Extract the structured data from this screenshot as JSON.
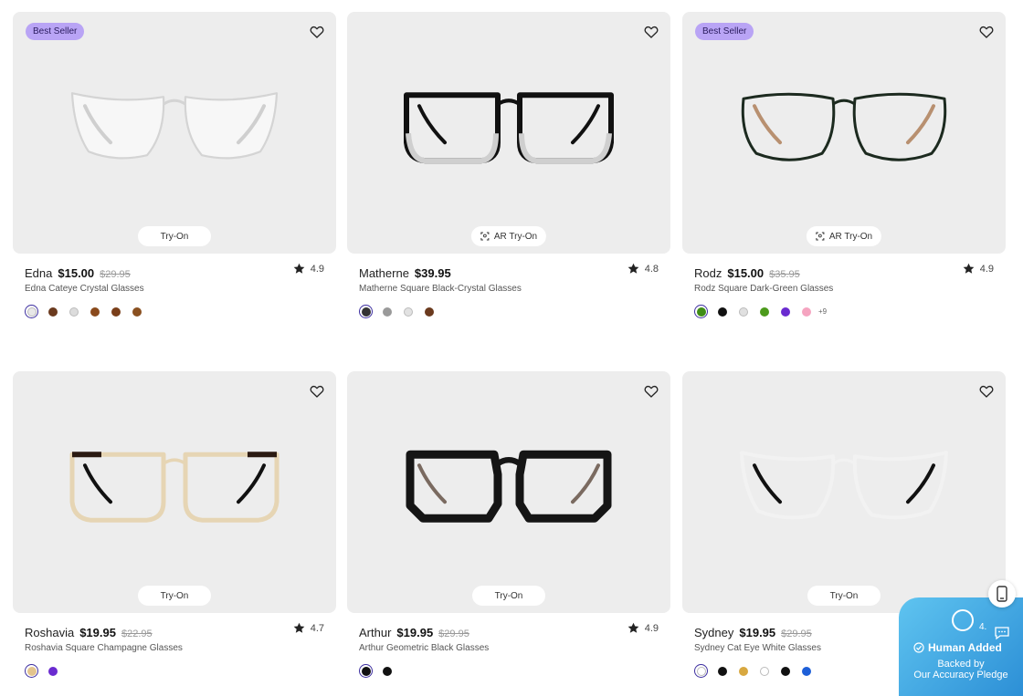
{
  "products": [
    {
      "badge": "Best Seller",
      "name": "Edna",
      "price": "$15.00",
      "old_price": "$29.95",
      "full_name": "Edna Cateye Crystal Glasses",
      "rating": "4.9",
      "try_on": "Try-On",
      "ar": false,
      "frame": "crystal",
      "swatches": [
        "#e8e8e8",
        "#6b3a1e",
        "#dcdcdc",
        "#8a4a1c",
        "#7a3f1a",
        "#8a5020"
      ],
      "more": ""
    },
    {
      "badge": "",
      "name": "Matherne",
      "price": "$39.95",
      "old_price": "",
      "full_name": "Matherne Square Black-Crystal Glasses",
      "rating": "4.8",
      "try_on": "AR Try-On",
      "ar": true,
      "frame": "blackcrystal",
      "swatches": [
        "#333333",
        "#9a9a9a",
        "#e2e2e2",
        "#6b3a1e"
      ],
      "more": ""
    },
    {
      "badge": "Best Seller",
      "name": "Rodz",
      "price": "$15.00",
      "old_price": "$35.95",
      "full_name": "Rodz Square Dark-Green Glasses",
      "rating": "4.9",
      "try_on": "AR Try-On",
      "ar": true,
      "frame": "darkgreen",
      "swatches": [
        "#3f8d16",
        "#111111",
        "#e0e0e0",
        "#4c9a1c",
        "#6a2bd0",
        "#f5a4c0"
      ],
      "more": "+9"
    },
    {
      "badge": "",
      "name": "Roshavia",
      "price": "$19.95",
      "old_price": "$22.95",
      "full_name": "Roshavia Square Champagne Glasses",
      "rating": "4.7",
      "try_on": "Try-On",
      "ar": false,
      "frame": "champagne",
      "swatches": [
        "#e3c48d",
        "#6a2bd0"
      ],
      "more": ""
    },
    {
      "badge": "",
      "name": "Arthur",
      "price": "$19.95",
      "old_price": "$29.95",
      "full_name": "Arthur Geometric Black Glasses",
      "rating": "4.9",
      "try_on": "Try-On",
      "ar": false,
      "frame": "geoblack",
      "swatches": [
        "#111111",
        "#111111"
      ],
      "more": ""
    },
    {
      "badge": "",
      "name": "Sydney",
      "price": "$19.95",
      "old_price": "$29.95",
      "full_name": "Sydney Cat Eye White Glasses",
      "rating": "",
      "try_on": "Try-On",
      "ar": false,
      "frame": "white",
      "swatches": [
        "#ffffff",
        "#111111",
        "#d8a840",
        "#ffffff",
        "#111111",
        "#1e5fd8"
      ],
      "more": ""
    }
  ],
  "pledge": {
    "title": "Human Added",
    "line1": "Backed by",
    "line2": "Our Accuracy Pledge",
    "number": "4."
  },
  "colors": {
    "badge": "#b9a4f5",
    "card_bg": "#ededed",
    "pledge_from": "#5fc4f0",
    "pledge_to": "#2c8fd6",
    "selected_ring": "#3d2fa0"
  },
  "icons": {
    "heart": "heart-icon",
    "star": "star-icon",
    "ar": "ar-scan-icon",
    "phone": "phone-icon",
    "chat": "chat-icon",
    "check": "check-circle-icon",
    "badge": "shield-badge-icon"
  }
}
